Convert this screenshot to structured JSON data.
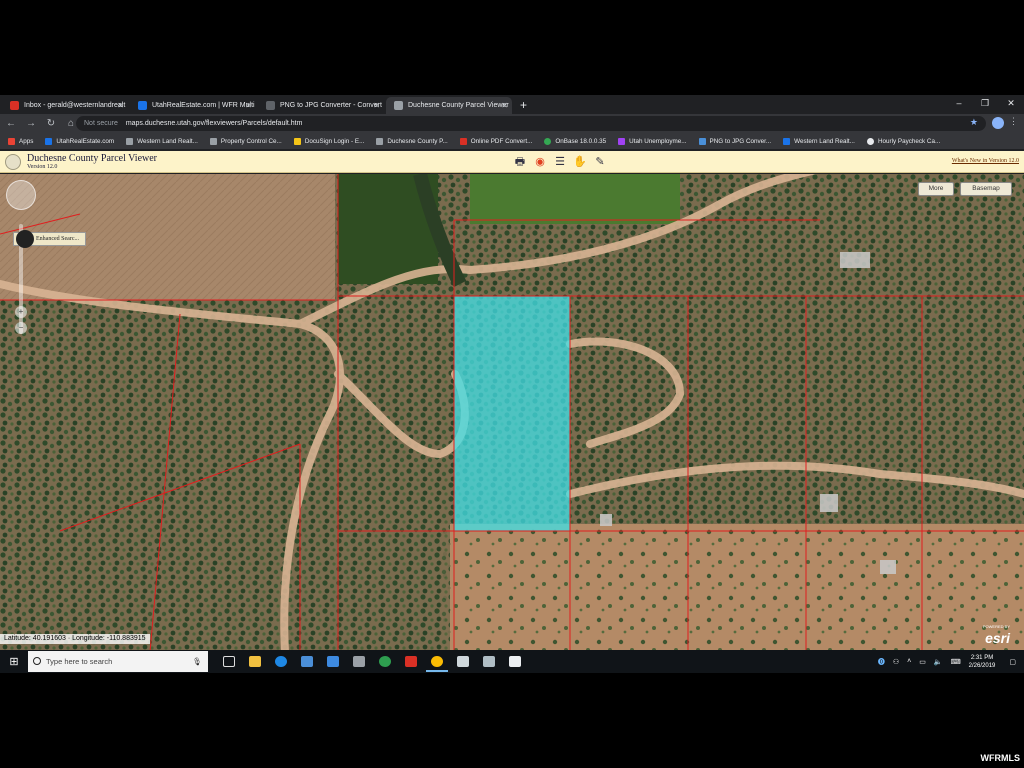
{
  "browser": {
    "tabs": [
      {
        "title": "Inbox - gerald@westernlandrealt",
        "color": "#d93025"
      },
      {
        "title": "UtahRealEstate.com | WFR Multi",
        "color": "#1a73e8"
      },
      {
        "title": "PNG to JPG Converter - Convert",
        "color": "#5f6368"
      },
      {
        "title": "Duchesne County Parcel Viewer",
        "color": "#9aa0a6"
      }
    ],
    "new_tab": "+",
    "window_controls": [
      "–",
      "❐",
      "✕"
    ],
    "nav": {
      "back": "←",
      "forward": "→",
      "reload": "↻",
      "home": "⌂"
    },
    "address": {
      "security": "Not secure",
      "url": "maps.duchesne.utah.gov/flexviewers/Parcels/default.htm"
    },
    "bookmarks": [
      {
        "label": "Apps"
      },
      {
        "label": "UtahRealEstate.com"
      },
      {
        "label": "Western Land Realt..."
      },
      {
        "label": "Property Control Ce..."
      },
      {
        "label": "DocuSign Login - E..."
      },
      {
        "label": "Duchesne County P..."
      },
      {
        "label": "Online PDF Convert..."
      },
      {
        "label": "OnBase 18.0.0.35"
      },
      {
        "label": "Utah Unemployme..."
      },
      {
        "label": "PNG to JPG Conver..."
      },
      {
        "label": "Western Land Realt..."
      },
      {
        "label": "Hourly Paycheck Ca..."
      }
    ]
  },
  "app": {
    "title": "Duchesne County Parcel Viewer",
    "version": "Version 12.0",
    "whats_new": "What's New in Version 12.0",
    "tools": [
      {
        "name": "print-icon",
        "glyph": "🖶"
      },
      {
        "name": "target-icon",
        "glyph": "◉"
      },
      {
        "name": "layers-list-icon",
        "glyph": "☰"
      },
      {
        "name": "pan-hand-icon",
        "glyph": "✋"
      },
      {
        "name": "draw-pencil-icon",
        "glyph": "✎"
      }
    ],
    "more_button": "More",
    "basemap_button": "Basemap",
    "enhanced_search": "Enhanced Searc...",
    "coordinates": "Latitude: 40.191603 · Longitude: -110.883915",
    "esri_credit": "POWERED BY",
    "esri": "esri"
  },
  "taskbar": {
    "search_placeholder": "Type here to search",
    "time": "2:31 PM",
    "date": "2/26/2019"
  },
  "watermark": "WFRMLS"
}
